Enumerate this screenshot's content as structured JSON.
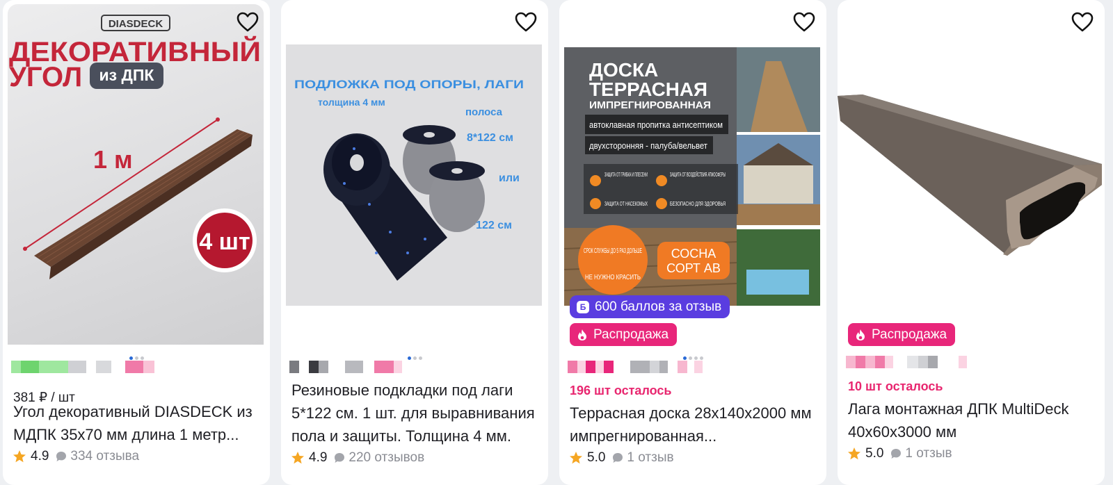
{
  "colors": {
    "accent_pink": "#e8266f",
    "bonus_purple": "#5a3de0",
    "star": "#f5a623"
  },
  "products": [
    {
      "image": {
        "brand": "DIASDECK",
        "headline1": "ДЕКОРАТИВНЫЙ",
        "headline2": "УГОЛ",
        "tag": "из ДПК",
        "length": "1 м",
        "qty_badge": "4 шт"
      },
      "unit_price": "381 ₽ / шт",
      "title": "Угол декоративный DIASDECK из МДПК 35х70 мм длина 1 метр...",
      "rating": "4.9",
      "reviews": "334 отзыва"
    },
    {
      "image": {
        "line1": "ПОДЛОЖКА ПОД ОПОРЫ, ЛАГИ",
        "line2": "толщина 4 мм",
        "line3": "полоса",
        "line4": "8*122 см",
        "line5": "или",
        "line6": "5*122 см"
      },
      "title": "Резиновые подкладки под лаги 5*122 см. 1 шт. для выравнивания пола и защиты. Толщина 4 мм.",
      "rating": "4.9",
      "reviews": "220 отзывов"
    },
    {
      "image": {
        "title1": "ДОСКА",
        "title2": "ТЕРРАСНАЯ",
        "title3": "ИМПРЕГНИРОВАННАЯ",
        "sub1": "автоклавная пропитка антисептиком",
        "sub2": "двухсторонняя - палуба/вельвет",
        "f1": "ЗАЩИТА ОТ ГРИБКА И ПЛЕСЕНИ",
        "f2": "ЗАЩИТА ОТ ВОЗДЕЙСТВИЯ АТМОСФЕРЫ",
        "f3": "ЗАЩИТА ОТ НАСЕКОМЫХ",
        "f4": "БЕЗОПАСНО ДЛЯ ЗДОРОВЬЯ",
        "circle1": "СРОК СЛУЖБЫ ДО 5 РАЗ ДОЛЬШЕ",
        "circle2": "НЕ НУЖНО КРАСИТЬ",
        "sort1": "СОСНА",
        "sort2": "СОРТ АВ"
      },
      "bonus": "600 баллов за отзыв",
      "bonus_icon": "Б",
      "sale": "Распродажа",
      "stock": "196 шт осталось",
      "title": "Террасная доска 28х140х2000 мм импрегнированная...",
      "rating": "5.0",
      "reviews": "1 отзыв"
    },
    {
      "sale": "Распродажа",
      "stock": "10 шт осталось",
      "title": "Лага монтажная ДПК MultiDeck 40х60х3000 мм",
      "rating": "5.0",
      "reviews": "1 отзыв"
    }
  ]
}
